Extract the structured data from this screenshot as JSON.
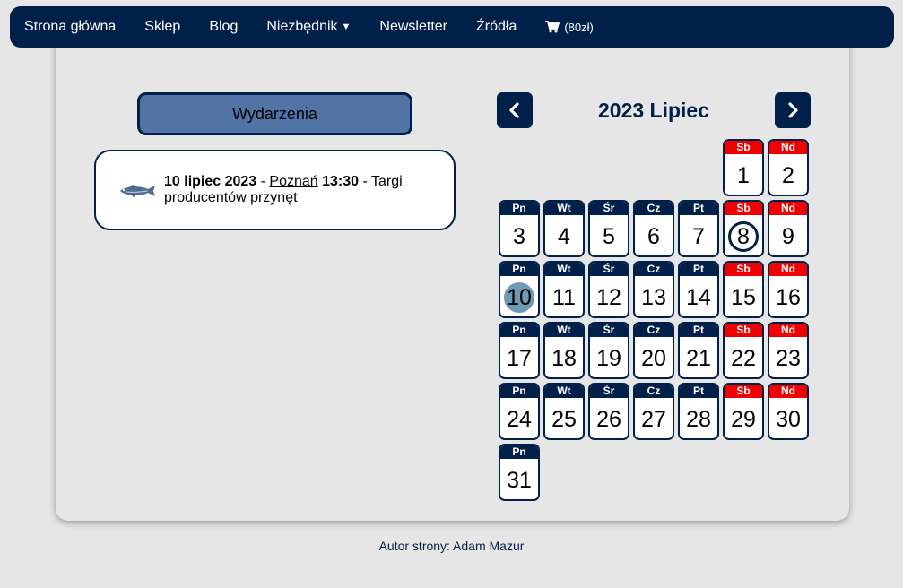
{
  "nav": {
    "items": [
      {
        "label": "Strona główna",
        "name": "nav-home"
      },
      {
        "label": "Sklep",
        "name": "nav-shop"
      },
      {
        "label": "Blog",
        "name": "nav-blog"
      },
      {
        "label": "Niezbędnik",
        "name": "nav-essentials",
        "dropdown": true
      },
      {
        "label": "Newsletter",
        "name": "nav-newsletter"
      },
      {
        "label": "Źródła",
        "name": "nav-sources"
      }
    ],
    "cart_label": "(80zł)",
    "cart_icon": "shopping-cart-icon"
  },
  "events": {
    "button_label": "Wydarzenia",
    "item": {
      "date": "10 lipiec 2023",
      "sep1": " - ",
      "city": "Poznań",
      "time": "13:30",
      "sep2": " - ",
      "title": "Targi producentów przynęt",
      "icon": "fish-icon"
    }
  },
  "calendar": {
    "title": "2023 Lipiec",
    "prev_icon": "chevron-left-icon",
    "next_icon": "chevron-right-icon",
    "weekdays": [
      "Pn",
      "Wt",
      "Śr",
      "Cz",
      "Pt",
      "Sb",
      "Nd"
    ],
    "first_weekday_index": 5,
    "days_in_month": 31,
    "today": 8,
    "event_days": [
      10
    ],
    "weekend_color": "#f00000",
    "header_color": "#00204a",
    "event_highlight_color": "#6f99b4"
  },
  "footer": {
    "text": "Autor strony: Adam Mazur"
  },
  "colors": {
    "navy": "#00204a",
    "button_blue": "#5173a6",
    "background": "#e6e6e6"
  }
}
